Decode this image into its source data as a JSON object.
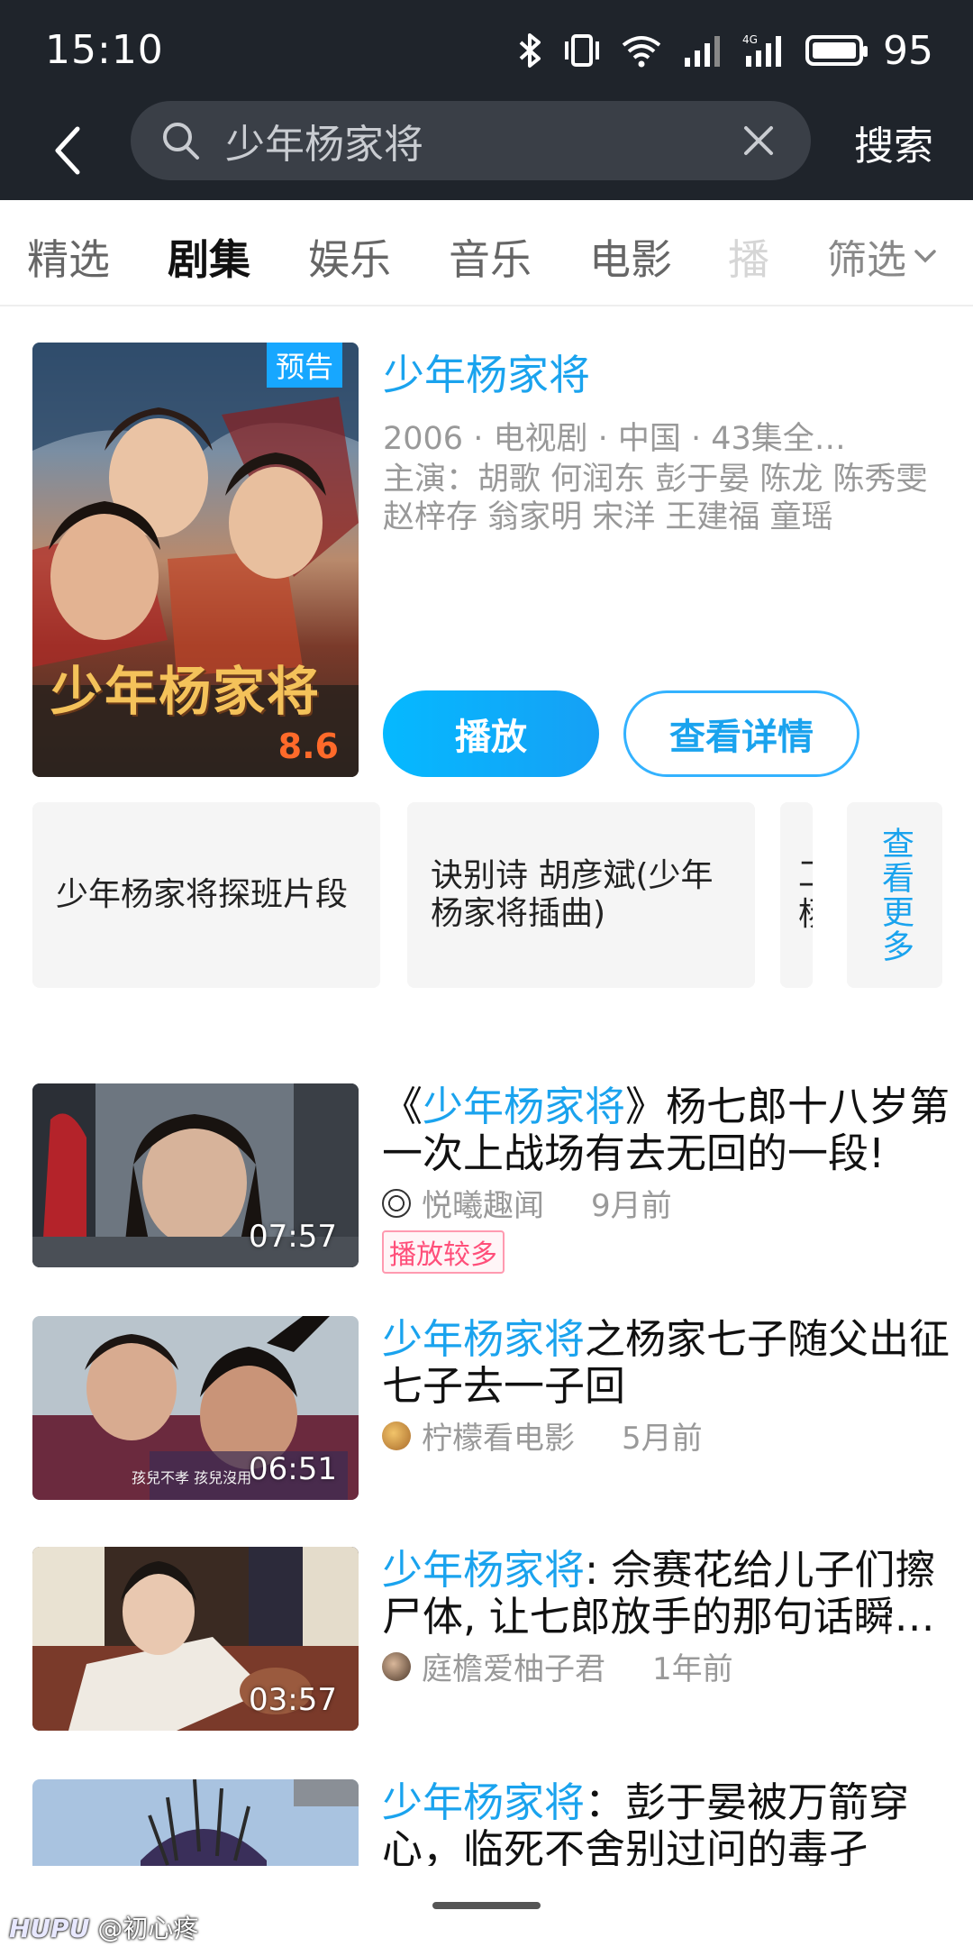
{
  "status_bar": {
    "time": "15:10",
    "battery_percent": "95",
    "icons": [
      "bluetooth-icon",
      "vibrate-icon",
      "wifi-icon",
      "signal-icon",
      "4g-signal-icon",
      "battery-icon"
    ]
  },
  "search": {
    "query": "少年杨家将",
    "button_label": "搜索"
  },
  "tabs": [
    {
      "label": "精选"
    },
    {
      "label": "剧集"
    },
    {
      "label": "娱乐"
    },
    {
      "label": "音乐"
    },
    {
      "label": "电影"
    },
    {
      "label": "播"
    }
  ],
  "active_tab": "剧集",
  "filter_label": "筛选",
  "feature": {
    "badge": "预告",
    "score": "8.6",
    "poster_title_art": "少年杨家将",
    "title": "少年杨家将",
    "meta": "2006 · 电视剧 · 中国 · 43集全…",
    "cast": "主演：胡歌 何润东 彭于晏 陈龙 陈秀雯 赵梓存 翁家明 宋洋 王建福 童瑶",
    "play_label": "播放",
    "detail_label": "查看详情"
  },
  "clips": [
    {
      "label": "少年杨家将探班片段"
    },
    {
      "label": "诀别诗 胡彦斌(少年杨家将插曲)"
    },
    {
      "label": "工杨"
    }
  ],
  "more_label": "查看更多",
  "videos": [
    {
      "title_prefix": "《",
      "title_highlight": "少年杨家将",
      "title_rest": "》杨七郎十八岁第一次上战场有去无回的一段!",
      "duration": "07:57",
      "author": "悦曦趣闻",
      "time": "9月前",
      "tag": "播放较多"
    },
    {
      "title_prefix": "",
      "title_highlight": "少年杨家将",
      "title_rest": "之杨家七子随父出征七子去一子回",
      "duration": "06:51",
      "subtitle": "孩兒不孝 孩兒沒用",
      "author": "柠檬看电影",
      "time": "5月前"
    },
    {
      "title_prefix": "",
      "title_highlight": "少年杨家将",
      "title_rest": ": 佘赛花给儿子们擦尸体, 让七郎放手的那句话瞬…",
      "duration": "03:57",
      "author": "庭檐爱柚子君",
      "time": "1年前"
    },
    {
      "title_prefix": "",
      "title_highlight": "少年杨家将",
      "title_rest": "：彭于晏被万箭穿心，临死不舍别过问的毒孑"
    }
  ],
  "watermark": {
    "logo": "HUPU",
    "handle": "@初心疼"
  },
  "colors": {
    "accent": "#1aa3ee",
    "header_bg": "#1f242b",
    "tag_pink": "#ff4f7a",
    "score_orange": "#ff6a2a"
  }
}
